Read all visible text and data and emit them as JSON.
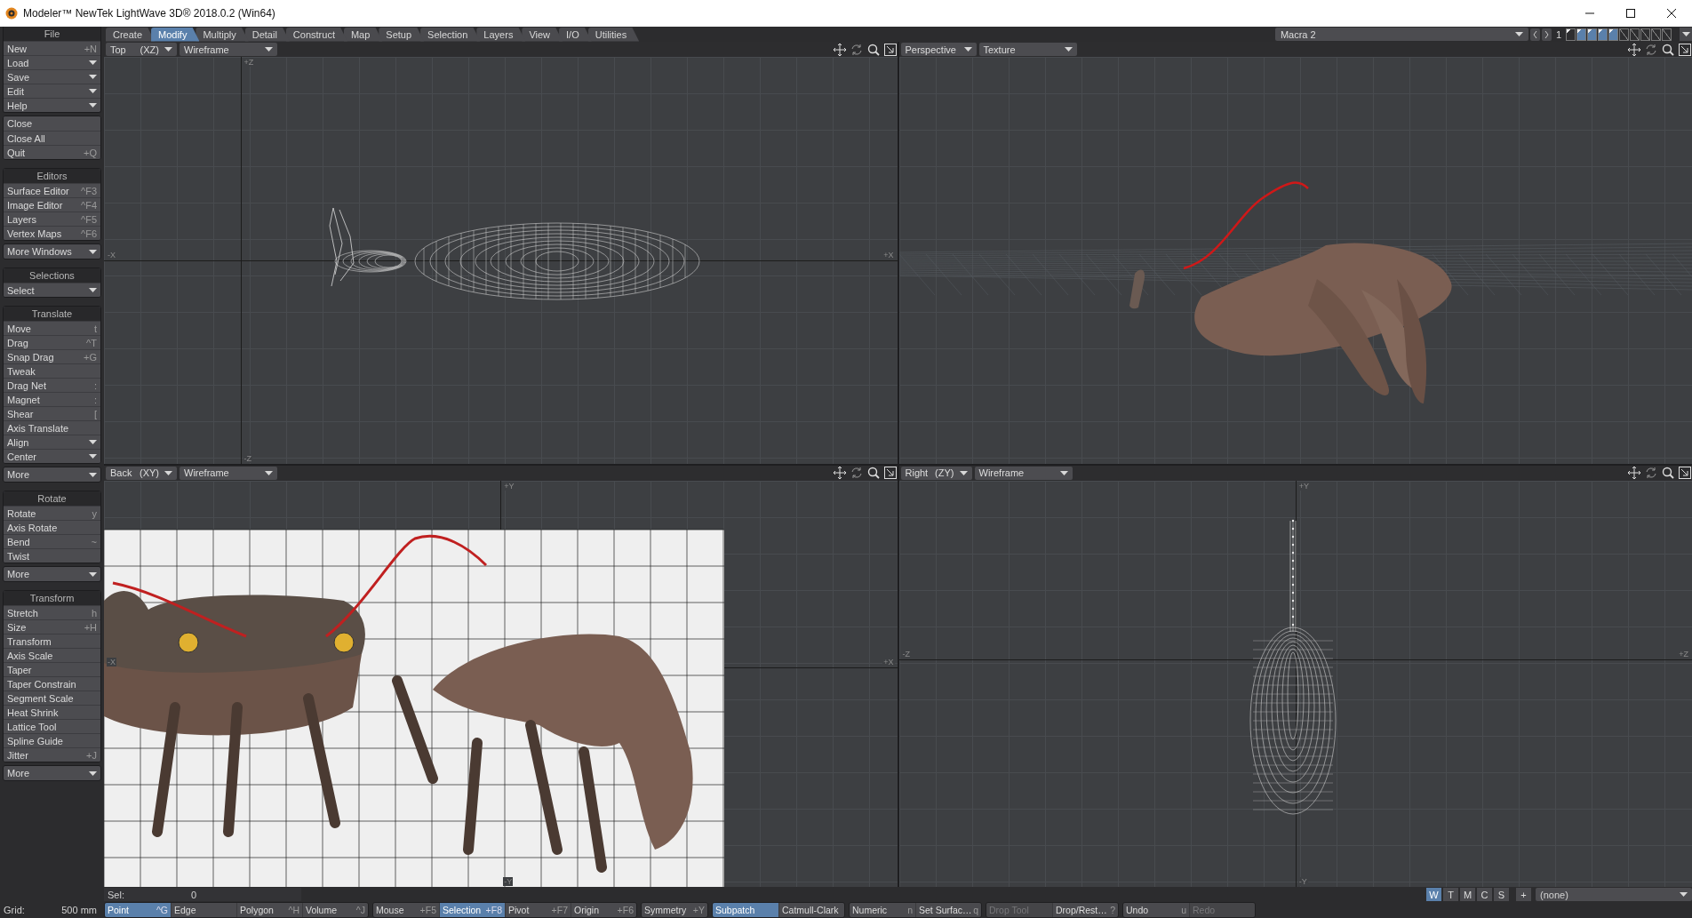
{
  "window": {
    "title": "Modeler™ NewTek LightWave 3D® 2018.0.2 (Win64)"
  },
  "sidebar": {
    "groups": [
      {
        "title": "File",
        "items": [
          {
            "label": "New",
            "shortcut": "+N",
            "kind": "command"
          },
          {
            "label": "Load",
            "kind": "menu"
          },
          {
            "label": "Save",
            "kind": "menu"
          },
          {
            "label": "Edit",
            "kind": "menu"
          },
          {
            "label": "Help",
            "kind": "menu"
          }
        ]
      },
      {
        "items": [
          {
            "label": "Close",
            "kind": "command"
          },
          {
            "label": "Close All",
            "kind": "command"
          },
          {
            "label": "Quit",
            "shortcut": "+Q",
            "kind": "command"
          }
        ]
      },
      {
        "title": "Editors",
        "items": [
          {
            "label": "Surface Editor",
            "shortcut": "^F3",
            "kind": "command"
          },
          {
            "label": "Image Editor",
            "shortcut": "^F4",
            "kind": "command"
          },
          {
            "label": "Layers",
            "shortcut": "^F5",
            "kind": "command"
          },
          {
            "label": "Vertex Maps",
            "shortcut": "^F6",
            "kind": "command"
          }
        ]
      },
      {
        "items": [
          {
            "label": "More Windows",
            "kind": "menu"
          }
        ]
      },
      {
        "title": "Selections",
        "items": [
          {
            "label": "Select",
            "kind": "menu"
          }
        ]
      },
      {
        "title": "Translate",
        "items": [
          {
            "label": "Move",
            "shortcut": "t",
            "kind": "command"
          },
          {
            "label": "Drag",
            "shortcut": "^T",
            "kind": "command"
          },
          {
            "label": "Snap Drag",
            "shortcut": "+G",
            "kind": "command"
          },
          {
            "label": "Tweak",
            "kind": "command"
          },
          {
            "label": "Drag Net",
            "shortcut": ":",
            "kind": "command"
          },
          {
            "label": "Magnet",
            "shortcut": ":",
            "kind": "command"
          },
          {
            "label": "Shear",
            "shortcut": "[",
            "kind": "command"
          },
          {
            "label": "Axis Translate",
            "kind": "command"
          },
          {
            "label": "Align",
            "kind": "menu"
          },
          {
            "label": "Center",
            "kind": "menu"
          }
        ]
      },
      {
        "items": [
          {
            "label": "More",
            "kind": "menu"
          }
        ]
      },
      {
        "title": "Rotate",
        "items": [
          {
            "label": "Rotate",
            "shortcut": "y",
            "kind": "command"
          },
          {
            "label": "Axis Rotate",
            "kind": "command"
          },
          {
            "label": "Bend",
            "shortcut": "~",
            "kind": "command"
          },
          {
            "label": "Twist",
            "kind": "command"
          }
        ]
      },
      {
        "items": [
          {
            "label": "More",
            "kind": "menu"
          }
        ]
      },
      {
        "title": "Transform",
        "items": [
          {
            "label": "Stretch",
            "shortcut": "h",
            "kind": "command"
          },
          {
            "label": "Size",
            "shortcut": "+H",
            "kind": "command"
          },
          {
            "label": "Transform",
            "kind": "command"
          },
          {
            "label": "Axis Scale",
            "kind": "command"
          },
          {
            "label": "Taper",
            "kind": "command"
          },
          {
            "label": "Taper Constrain",
            "kind": "command"
          },
          {
            "label": "Segment Scale",
            "kind": "command"
          },
          {
            "label": "Heat Shrink",
            "kind": "command"
          },
          {
            "label": "Lattice Tool",
            "kind": "command"
          },
          {
            "label": "Spline Guide",
            "kind": "command"
          },
          {
            "label": "Jitter",
            "shortcut": "+J",
            "kind": "command"
          }
        ]
      },
      {
        "items": [
          {
            "label": "More",
            "kind": "menu"
          }
        ]
      }
    ]
  },
  "tabs": [
    {
      "label": "Create",
      "selected": false
    },
    {
      "label": "Modify",
      "selected": true
    },
    {
      "label": "Multiply",
      "selected": false
    },
    {
      "label": "Detail",
      "selected": false
    },
    {
      "label": "Construct",
      "selected": false
    },
    {
      "label": "Map",
      "selected": false
    },
    {
      "label": "Setup",
      "selected": false
    },
    {
      "label": "Selection",
      "selected": false
    },
    {
      "label": "Layers",
      "selected": false
    },
    {
      "label": "View",
      "selected": false
    },
    {
      "label": "I/O",
      "selected": false
    },
    {
      "label": "Utilities",
      "selected": false
    }
  ],
  "layer_selector": {
    "value": "Macra 2",
    "number": "1",
    "layers": [
      {
        "selected": false,
        "has_geometry": true
      },
      {
        "selected": true,
        "has_geometry": true
      },
      {
        "selected": true,
        "has_geometry": true
      },
      {
        "selected": true,
        "has_geometry": true
      },
      {
        "selected": true,
        "has_geometry": true
      },
      {
        "selected": false,
        "has_geometry": false
      },
      {
        "selected": false,
        "has_geometry": false
      },
      {
        "selected": false,
        "has_geometry": false
      },
      {
        "selected": false,
        "has_geometry": false
      },
      {
        "selected": false,
        "has_geometry": false
      }
    ]
  },
  "viewports": [
    {
      "kind": "top",
      "view": "Top",
      "axes": "(XZ)",
      "mode": "Wireframe",
      "axis_labels": {
        "top": "+Z",
        "bottom": "-Z",
        "left": "-X",
        "right": "+X"
      }
    },
    {
      "kind": "perspective",
      "view": "Perspective",
      "mode": "Texture"
    },
    {
      "kind": "back",
      "view": "Back",
      "axes": "(XY)",
      "mode": "Wireframe",
      "axis_labels": {
        "top": "+Y",
        "bottom": "-Y",
        "left": "-X",
        "right": "+X"
      }
    },
    {
      "kind": "right",
      "view": "Right",
      "axes": "(ZY)",
      "mode": "Wireframe",
      "axis_labels": {
        "top": "+Y",
        "bottom": "-Y",
        "left": "-Z",
        "right": "+Z"
      }
    }
  ],
  "status": {
    "sel": {
      "label": "Sel:",
      "value": "0"
    },
    "modes": [
      {
        "label": "W",
        "selected": true
      },
      {
        "label": "T",
        "selected": false
      },
      {
        "label": "M",
        "selected": false
      },
      {
        "label": "C",
        "selected": false
      },
      {
        "label": "S",
        "selected": false
      }
    ],
    "add_button": "+",
    "surface": {
      "value": "(none)"
    }
  },
  "bottom_bar": {
    "grid": {
      "label": "Grid:",
      "value": "500 mm"
    },
    "groups": [
      [
        {
          "label": "Point",
          "shortcut": "^G",
          "selected": true,
          "disabled": false
        },
        {
          "label": "Edge",
          "selected": false,
          "disabled": false
        },
        {
          "label": "Polygon",
          "shortcut": "^H",
          "selected": false,
          "disabled": false
        },
        {
          "label": "Volume",
          "shortcut": "^J",
          "selected": false,
          "disabled": false
        }
      ],
      [
        {
          "label": "Mouse",
          "shortcut": "+F5",
          "selected": false,
          "disabled": false
        },
        {
          "label": "Selection",
          "shortcut": "+F8",
          "selected": true,
          "disabled": false
        },
        {
          "label": "Pivot",
          "shortcut": "+F7",
          "selected": false,
          "disabled": false
        },
        {
          "label": "Origin",
          "shortcut": "+F6",
          "selected": false,
          "disabled": false
        }
      ],
      [
        {
          "label": "Symmetry",
          "shortcut": "+Y",
          "selected": false,
          "disabled": false
        }
      ],
      [
        {
          "label": "Subpatch",
          "selected": true,
          "disabled": false
        },
        {
          "label": "Catmull-Clark",
          "selected": false,
          "disabled": false
        }
      ],
      [
        {
          "label": "Numeric",
          "shortcut": "n",
          "selected": false,
          "disabled": false
        },
        {
          "label": "Set Surfac…",
          "shortcut": "q",
          "selected": false,
          "disabled": false
        }
      ],
      [
        {
          "label": "Drop Tool",
          "selected": false,
          "disabled": true
        },
        {
          "label": "Drop/Rest…",
          "shortcut": "?",
          "selected": false,
          "disabled": false
        }
      ],
      [
        {
          "label": "Undo",
          "shortcut": "u",
          "selected": false,
          "disabled": false
        },
        {
          "label": "Redo",
          "selected": false,
          "disabled": true
        }
      ]
    ]
  }
}
